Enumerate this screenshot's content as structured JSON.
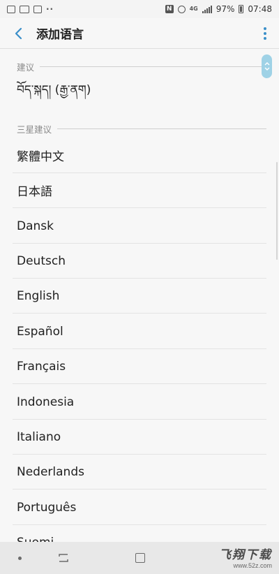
{
  "status_bar": {
    "battery_text": "97%",
    "time": "07:48",
    "network": "4G"
  },
  "header": {
    "title": "添加语言"
  },
  "icons": {
    "back": "back-arrow-icon",
    "more": "more-vert-icon",
    "scroll": "fast-scroll-handle-icon"
  },
  "colors": {
    "accent": "#3a8fc9",
    "scroll_handle": "#9fd2e6"
  },
  "sections": {
    "suggested": {
      "label": "建议",
      "items": [
        "བོད་སྐད། (རྒྱ་ནག)"
      ]
    },
    "samsung_suggested": {
      "label": "三星建议",
      "items": [
        "繁體中文",
        "日本語",
        "Dansk",
        "Deutsch",
        "English",
        "Español",
        "Français",
        "Indonesia",
        "Italiano",
        "Nederlands",
        "Português",
        "Suomi"
      ]
    }
  },
  "watermark": {
    "logo": "飞翔下载",
    "url": "www.52z.com"
  }
}
